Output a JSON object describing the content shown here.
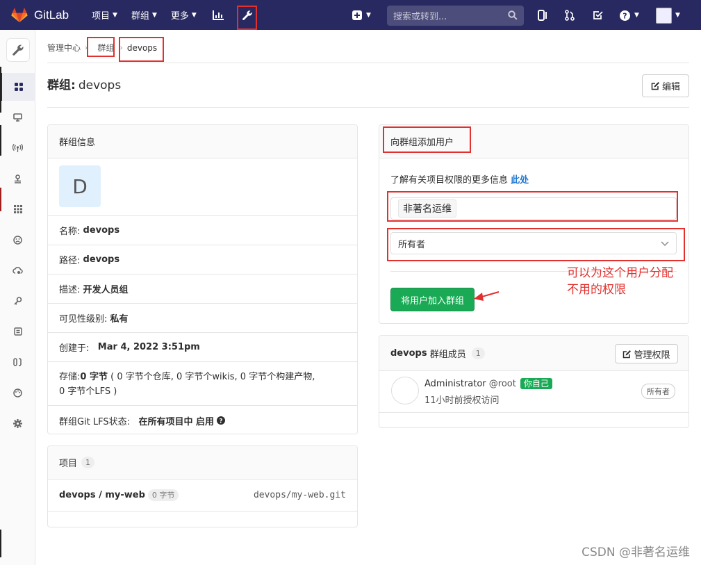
{
  "app": {
    "name": "GitLab"
  },
  "nav": {
    "projects": "项目",
    "groups": "群组",
    "more": "更多",
    "search_placeholder": "搜索或转到..."
  },
  "breadcrumb": {
    "root": "管理中心",
    "groups": "群组",
    "current": "devops"
  },
  "page": {
    "title_prefix": "群组:",
    "title_name": "devops",
    "edit_label": "编辑"
  },
  "group_info": {
    "header": "群组信息",
    "avatar_letter": "D",
    "name_label": "名称:",
    "name_value": "devops",
    "path_label": "路径:",
    "path_value": "devops",
    "desc_label": "描述:",
    "desc_value": "开发人员组",
    "visibility_label": "可见性级别:",
    "visibility_value": "私有",
    "created_label": "创建于:",
    "created_value": "Mar 4, 2022 3:51pm",
    "storage_label": "存储:",
    "storage_value": "0 字节",
    "storage_detail_1": "( 0 字节个仓库, 0 字节个wikis, 0 字节个构建产物,",
    "storage_detail_2": "0 字节个LFS )",
    "lfs_label": "群组Git LFS状态:",
    "lfs_value": "在所有项目中 启用"
  },
  "projects_card": {
    "header": "项目",
    "count": "1",
    "items": [
      {
        "name": "devops / my-web",
        "size": "0 字节",
        "path": "devops/my-web.git"
      }
    ]
  },
  "add_user": {
    "header": "向群组添加用户",
    "help_text": "了解有关项目权限的更多信息",
    "help_link": "此处",
    "user_token": "非著名运维",
    "role_value": "所有者",
    "submit_label": "将用户加入群组"
  },
  "members": {
    "header_group": "devops",
    "header_text": "群组成员",
    "count": "1",
    "manage_label": "管理权限",
    "items": [
      {
        "name": "Administrator",
        "username": "@root",
        "self_badge": "你自己",
        "access": "11小时前授权访问",
        "role": "所有者"
      }
    ]
  },
  "annotation": {
    "line1": "可以为这个用户分配",
    "line2": "不用的权限"
  },
  "watermark": "CSDN @非著名运维",
  "colors": {
    "nav_bg": "#292961",
    "accent_green": "#1aaa55",
    "annotation_red": "#e2302e",
    "link_blue": "#1f78d1"
  }
}
